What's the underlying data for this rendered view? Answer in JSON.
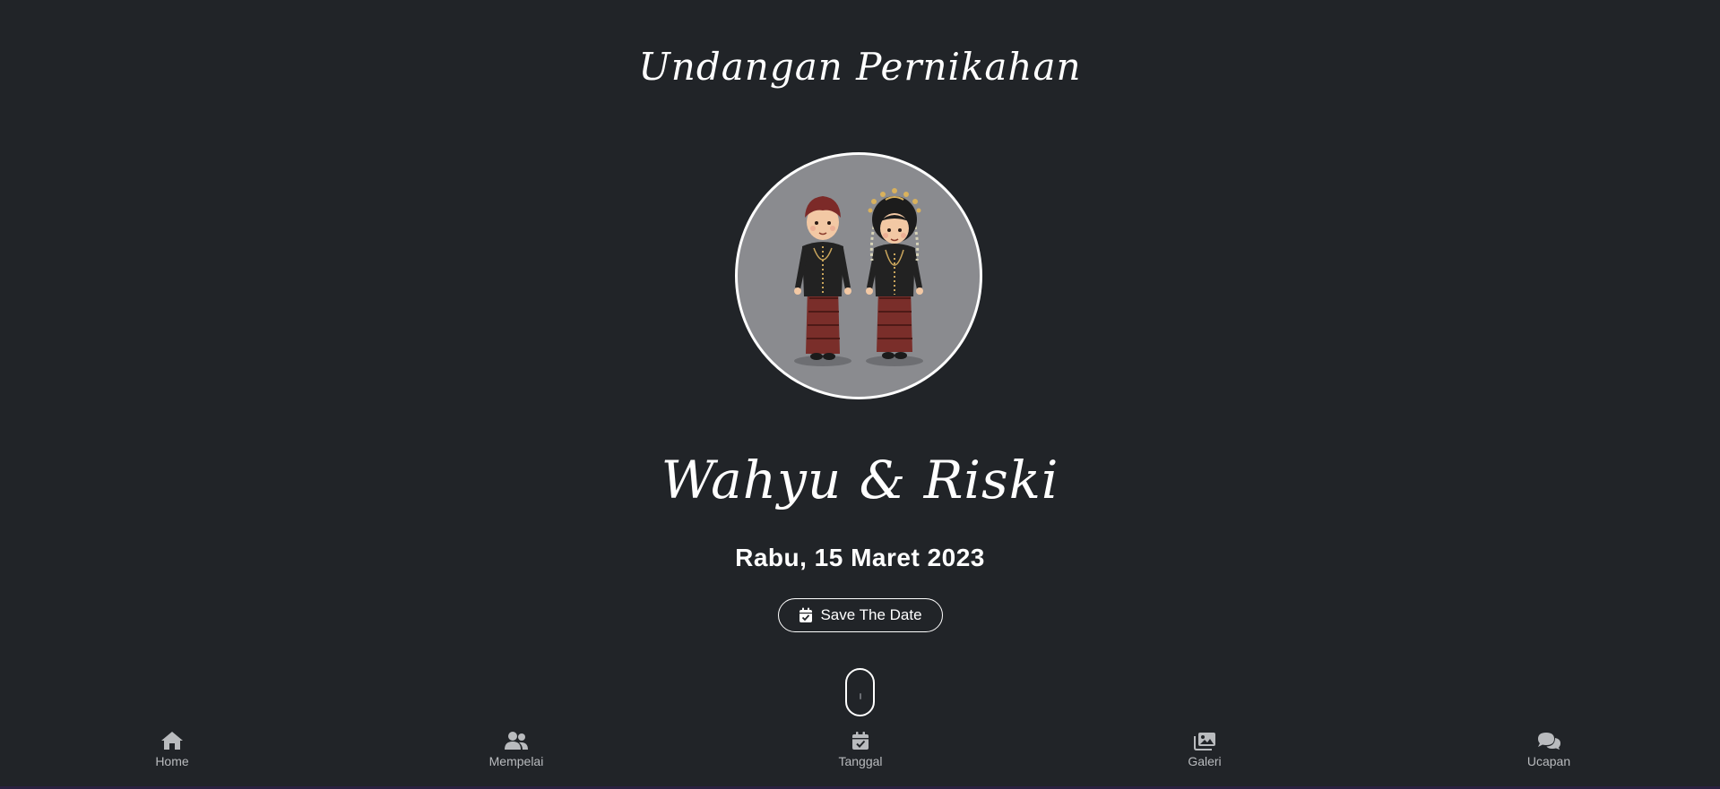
{
  "header": {
    "title": "Undangan Pernikahan"
  },
  "couple": {
    "names": "Wahyu & Riski"
  },
  "event": {
    "date": "Rabu, 15 Maret 2023"
  },
  "save_button": {
    "label": "Save The Date",
    "icon": "calendar-check-icon"
  },
  "nav": {
    "items": [
      {
        "label": "Home",
        "icon": "home-icon"
      },
      {
        "label": "Mempelai",
        "icon": "users-icon"
      },
      {
        "label": "Tanggal",
        "icon": "calendar-check-icon"
      },
      {
        "label": "Galeri",
        "icon": "images-icon"
      },
      {
        "label": "Ucapan",
        "icon": "comments-icon"
      }
    ]
  },
  "colors": {
    "background": "#212428",
    "text": "#ffffff",
    "nav_text": "#b9bbbe",
    "photo_bg": "#8a8b8f"
  }
}
